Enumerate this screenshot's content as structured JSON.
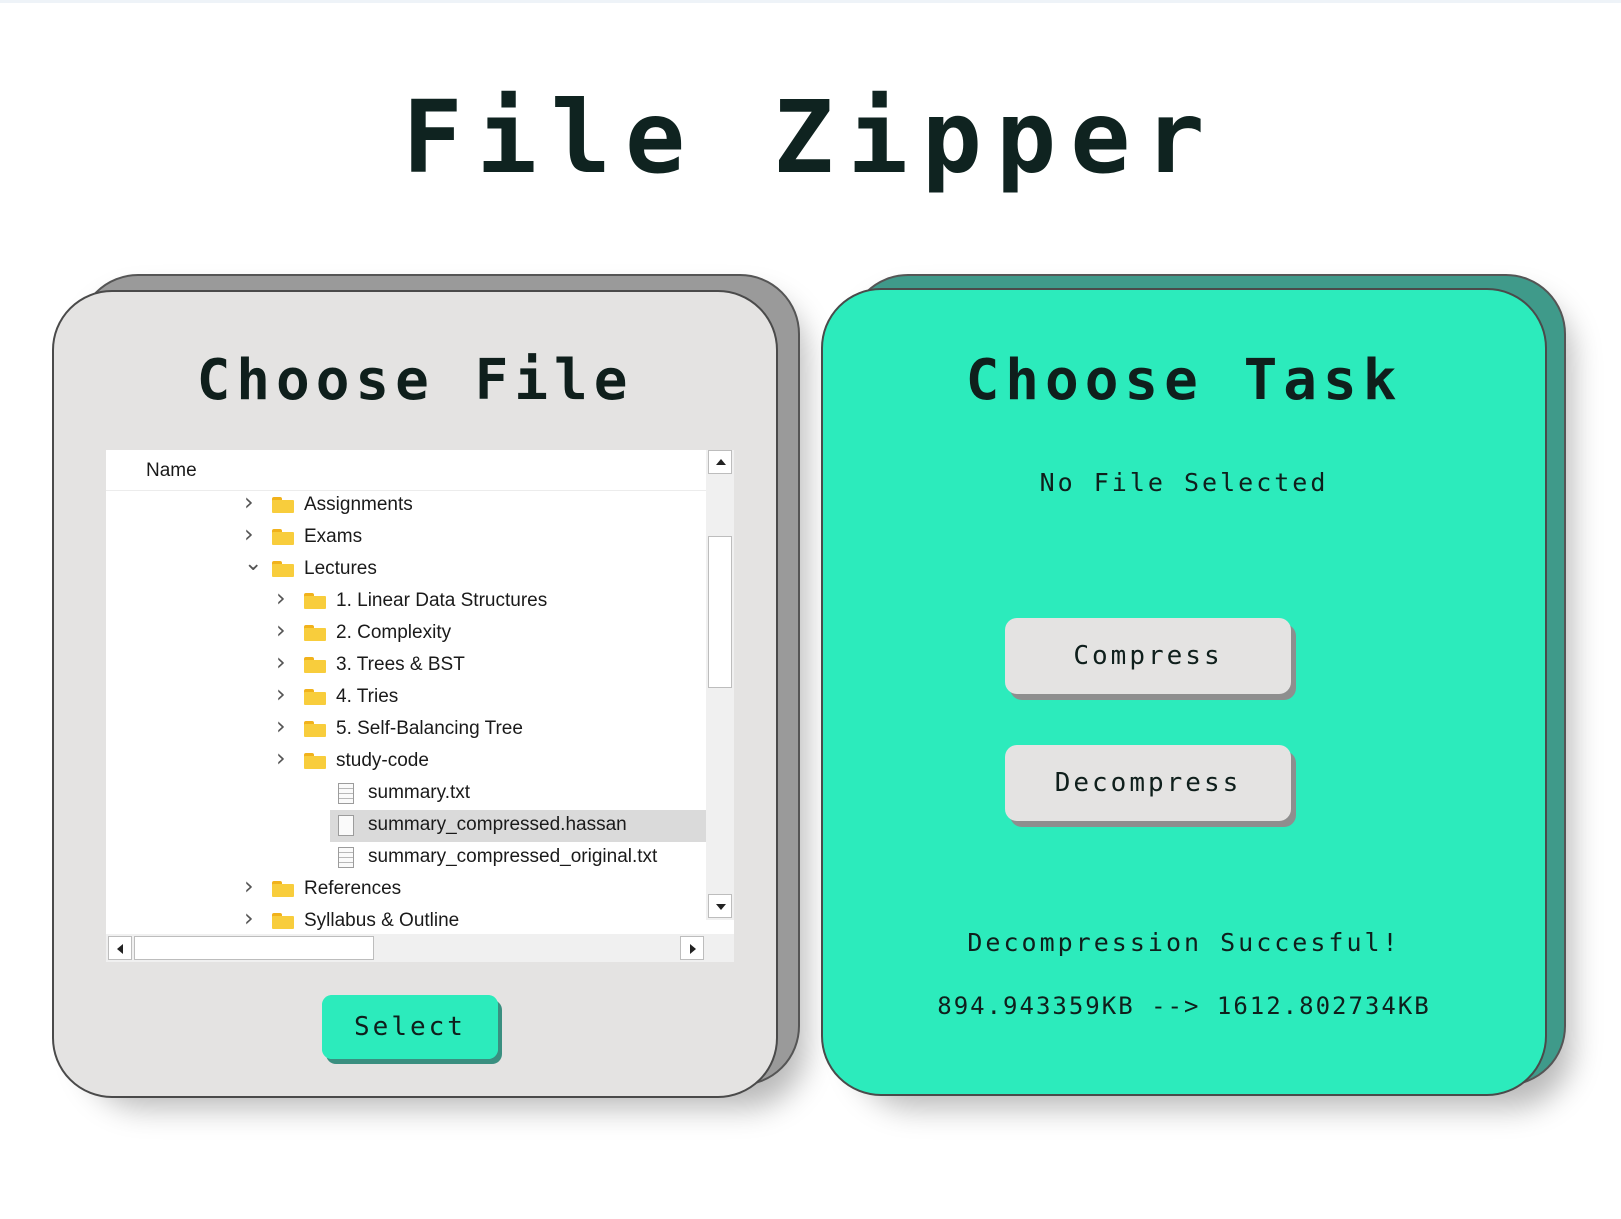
{
  "app": {
    "title": "File Zipper"
  },
  "file_panel": {
    "heading": "Choose File",
    "column_header": "Name",
    "tree": [
      {
        "label": "Assignments",
        "type": "folder",
        "level": 0,
        "expanded": false
      },
      {
        "label": "Exams",
        "type": "folder",
        "level": 0,
        "expanded": false
      },
      {
        "label": "Lectures",
        "type": "folder",
        "level": 0,
        "expanded": true
      },
      {
        "label": "1. Linear Data Structures",
        "type": "folder",
        "level": 1,
        "expanded": false
      },
      {
        "label": "2. Complexity",
        "type": "folder",
        "level": 1,
        "expanded": false
      },
      {
        "label": "3. Trees & BST",
        "type": "folder",
        "level": 1,
        "expanded": false
      },
      {
        "label": "4. Tries",
        "type": "folder",
        "level": 1,
        "expanded": false
      },
      {
        "label": "5. Self-Balancing Tree",
        "type": "folder",
        "level": 1,
        "expanded": false
      },
      {
        "label": "study-code",
        "type": "folder",
        "level": 1,
        "expanded": false
      },
      {
        "label": "summary.txt",
        "type": "text-file",
        "level": 1
      },
      {
        "label": "summary_compressed.hassan",
        "type": "file",
        "level": 1,
        "selected": true
      },
      {
        "label": "summary_compressed_original.txt",
        "type": "text-file",
        "level": 1
      },
      {
        "label": "References",
        "type": "folder",
        "level": 0,
        "expanded": false
      },
      {
        "label": "Syllabus & Outline",
        "type": "folder",
        "level": 0,
        "expanded": false
      }
    ],
    "select_label": "Select"
  },
  "task_panel": {
    "heading": "Choose Task",
    "selected_file_text": "No File Selected",
    "compress_label": "Compress",
    "decompress_label": "Decompress",
    "result_text": "Decompression Succesful!",
    "size_text": "894.943359KB --> 1612.802734KB"
  },
  "colors": {
    "accent": "#2cebbc",
    "accent_shadow": "#3f9a8a",
    "panel_gray": "#e4e3e2",
    "panel_gray_shadow": "#9a9a9a",
    "folder": "#f8cd3c",
    "text": "#0f1f1c"
  },
  "icons": {
    "collapsed": "chevron-right-icon",
    "expanded": "chevron-down-icon",
    "folder": "folder-icon",
    "file": "file-icon",
    "text_file": "text-file-icon"
  }
}
